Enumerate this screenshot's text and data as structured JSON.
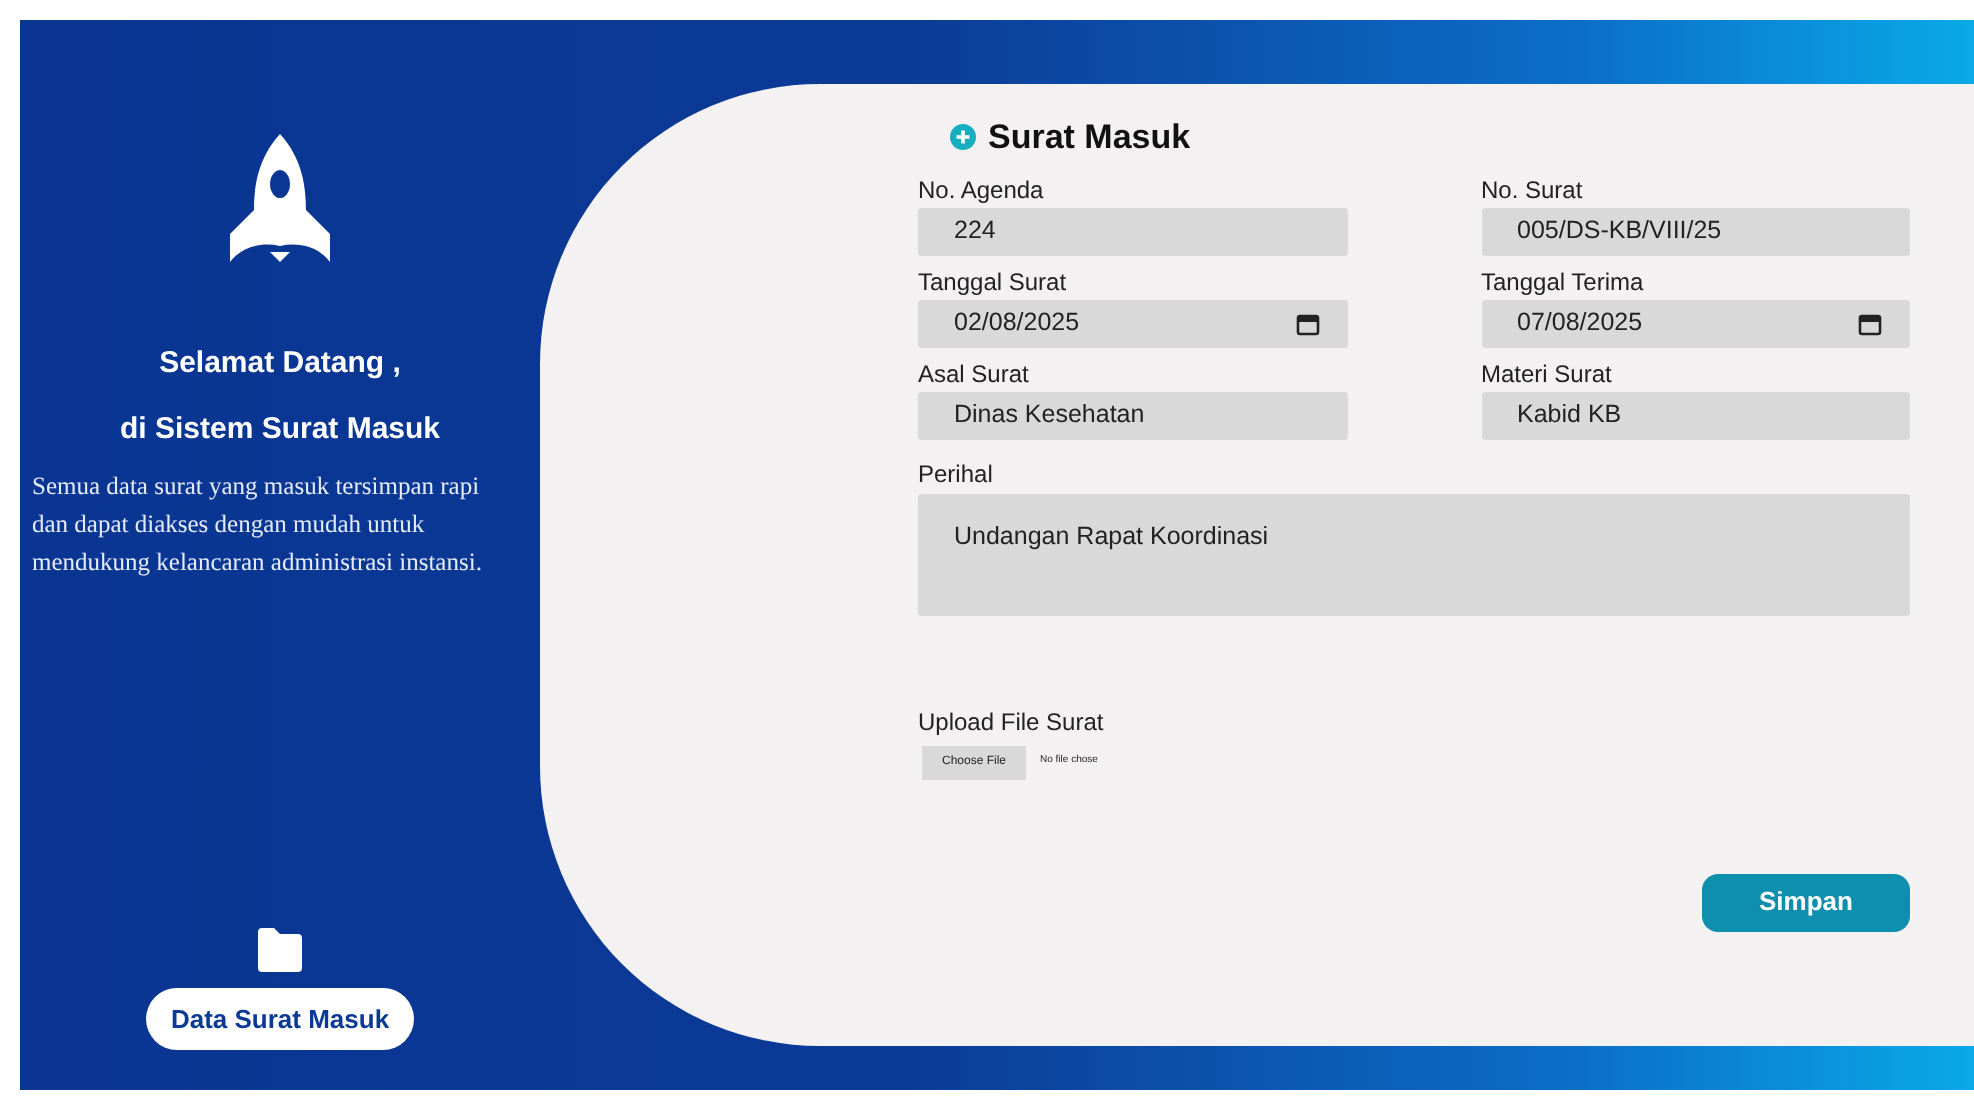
{
  "sidebar": {
    "title_lines": [
      "Selamat Datang ,",
      "di Sistem Surat Masuk"
    ],
    "description": "Semua data surat yang masuk tersimpan rapi dan dapat diakses dengan mudah untuk mendukung kelancaran administrasi instansi.",
    "nav_button": "Data Surat Masuk"
  },
  "form": {
    "title": "Surat Masuk",
    "fields": [
      {
        "label": "No. Agenda",
        "value": "224",
        "kind": "text"
      },
      {
        "label": "No. Surat",
        "value": "005/DS-KB/VIII/25",
        "kind": "text"
      },
      {
        "label": "Tanggal Surat",
        "value": "02/08/2025",
        "kind": "date"
      },
      {
        "label": "Tanggal Terima",
        "value": "07/08/2025",
        "kind": "date"
      },
      {
        "label": "Asal Surat",
        "value": "Dinas Kesehatan",
        "kind": "text"
      },
      {
        "label": "Materi Surat",
        "value": "Kabid KB",
        "kind": "text"
      }
    ],
    "perihal": {
      "label": "Perihal",
      "value": "Undangan Rapat Koordinasi"
    },
    "upload": {
      "label": "Upload File Surat",
      "button": "Choose File",
      "status": "No file chose"
    },
    "submit": "Simpan"
  }
}
